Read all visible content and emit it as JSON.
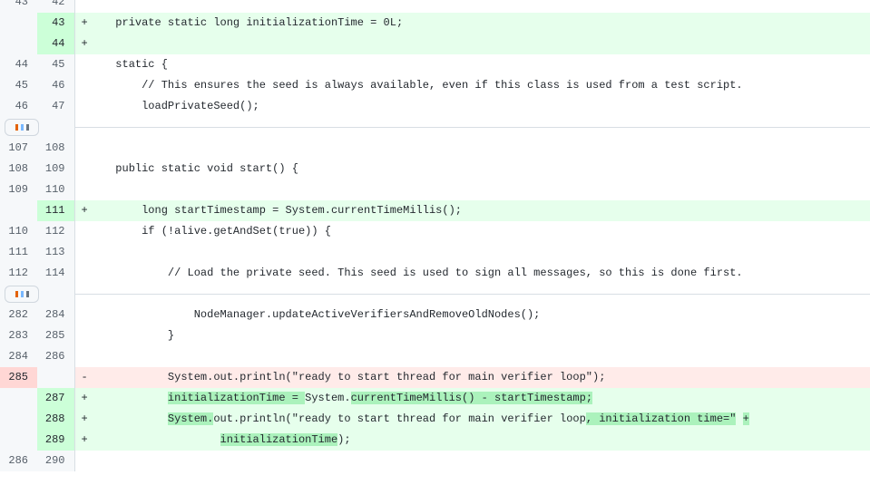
{
  "view": {
    "type": "unified-diff",
    "language": "java",
    "colors": {
      "added_line_bg": "#e6ffec",
      "added_gutter_bg": "#ccffd8",
      "added_word_bg": "#abf2bc",
      "deleted_line_bg": "#ffebe9",
      "deleted_gutter_bg": "#ffd7d5",
      "gutter_bg": "#f6f8fa",
      "border": "#d8dee4",
      "text": "#24292f",
      "line_number_text": "#57606a"
    }
  },
  "expander": {
    "label": "…",
    "title": "Expand hidden lines"
  },
  "rows": [
    {
      "kind": "context",
      "old": "43",
      "new": "42",
      "marker": "",
      "segments": [
        {
          "text": "",
          "hl": false
        }
      ]
    },
    {
      "kind": "add",
      "old": "",
      "new": "43",
      "marker": "+",
      "segments": [
        {
          "text": "    private static long initializationTime = 0L;",
          "hl": false
        }
      ]
    },
    {
      "kind": "add",
      "old": "",
      "new": "44",
      "marker": "+",
      "segments": [
        {
          "text": "",
          "hl": false
        }
      ]
    },
    {
      "kind": "context",
      "old": "44",
      "new": "45",
      "marker": "",
      "segments": [
        {
          "text": "    static {",
          "hl": false
        }
      ]
    },
    {
      "kind": "context",
      "old": "45",
      "new": "46",
      "marker": "",
      "segments": [
        {
          "text": "        // This ensures the seed is always available, even if this class is used from a test script.",
          "hl": false
        }
      ]
    },
    {
      "kind": "context",
      "old": "46",
      "new": "47",
      "marker": "",
      "segments": [
        {
          "text": "        loadPrivateSeed();",
          "hl": false
        }
      ]
    },
    {
      "kind": "hunk"
    },
    {
      "kind": "context",
      "old": "107",
      "new": "108",
      "marker": "",
      "segments": [
        {
          "text": "",
          "hl": false
        }
      ]
    },
    {
      "kind": "context",
      "old": "108",
      "new": "109",
      "marker": "",
      "segments": [
        {
          "text": "    public static void start() {",
          "hl": false
        }
      ]
    },
    {
      "kind": "context",
      "old": "109",
      "new": "110",
      "marker": "",
      "segments": [
        {
          "text": "",
          "hl": false
        }
      ]
    },
    {
      "kind": "add",
      "old": "",
      "new": "111",
      "marker": "+",
      "segments": [
        {
          "text": "        long startTimestamp = System.currentTimeMillis();",
          "hl": false
        }
      ]
    },
    {
      "kind": "context",
      "old": "110",
      "new": "112",
      "marker": "",
      "segments": [
        {
          "text": "        if (!alive.getAndSet(true)) {",
          "hl": false
        }
      ]
    },
    {
      "kind": "context",
      "old": "111",
      "new": "113",
      "marker": "",
      "segments": [
        {
          "text": "",
          "hl": false
        }
      ]
    },
    {
      "kind": "context",
      "old": "112",
      "new": "114",
      "marker": "",
      "segments": [
        {
          "text": "            // Load the private seed. This seed is used to sign all messages, so this is done first.",
          "hl": false
        }
      ]
    },
    {
      "kind": "hunk"
    },
    {
      "kind": "context",
      "old": "282",
      "new": "284",
      "marker": "",
      "segments": [
        {
          "text": "                NodeManager.updateActiveVerifiersAndRemoveOldNodes();",
          "hl": false
        }
      ]
    },
    {
      "kind": "context",
      "old": "283",
      "new": "285",
      "marker": "",
      "segments": [
        {
          "text": "            }",
          "hl": false
        }
      ]
    },
    {
      "kind": "context",
      "old": "284",
      "new": "286",
      "marker": "",
      "segments": [
        {
          "text": "",
          "hl": false
        }
      ]
    },
    {
      "kind": "del",
      "old": "285",
      "new": "",
      "marker": "-",
      "segments": [
        {
          "text": "            System.out.println(\"ready to start thread for main verifier loop\");",
          "hl": false
        }
      ]
    },
    {
      "kind": "add",
      "old": "",
      "new": "287",
      "marker": "+",
      "segments": [
        {
          "text": "            ",
          "hl": false
        },
        {
          "text": "initializationTime = ",
          "hl": true
        },
        {
          "text": "System.",
          "hl": false
        },
        {
          "text": "currentTimeMillis() - startTimestamp;",
          "hl": true
        }
      ]
    },
    {
      "kind": "add",
      "old": "",
      "new": "288",
      "marker": "+",
      "segments": [
        {
          "text": "            ",
          "hl": false
        },
        {
          "text": "System.",
          "hl": true
        },
        {
          "text": "out.println(\"ready to start thread for main verifier loop",
          "hl": false
        },
        {
          "text": ", initialization time=\"",
          "hl": true
        },
        {
          "text": " ",
          "hl": false
        },
        {
          "text": "+",
          "hl": true
        }
      ]
    },
    {
      "kind": "add",
      "old": "",
      "new": "289",
      "marker": "+",
      "segments": [
        {
          "text": "                    ",
          "hl": false
        },
        {
          "text": "initializationTime",
          "hl": true
        },
        {
          "text": ");",
          "hl": false
        }
      ]
    },
    {
      "kind": "context",
      "old": "286",
      "new": "290",
      "marker": "",
      "segments": [
        {
          "text": "",
          "hl": false
        }
      ]
    }
  ]
}
